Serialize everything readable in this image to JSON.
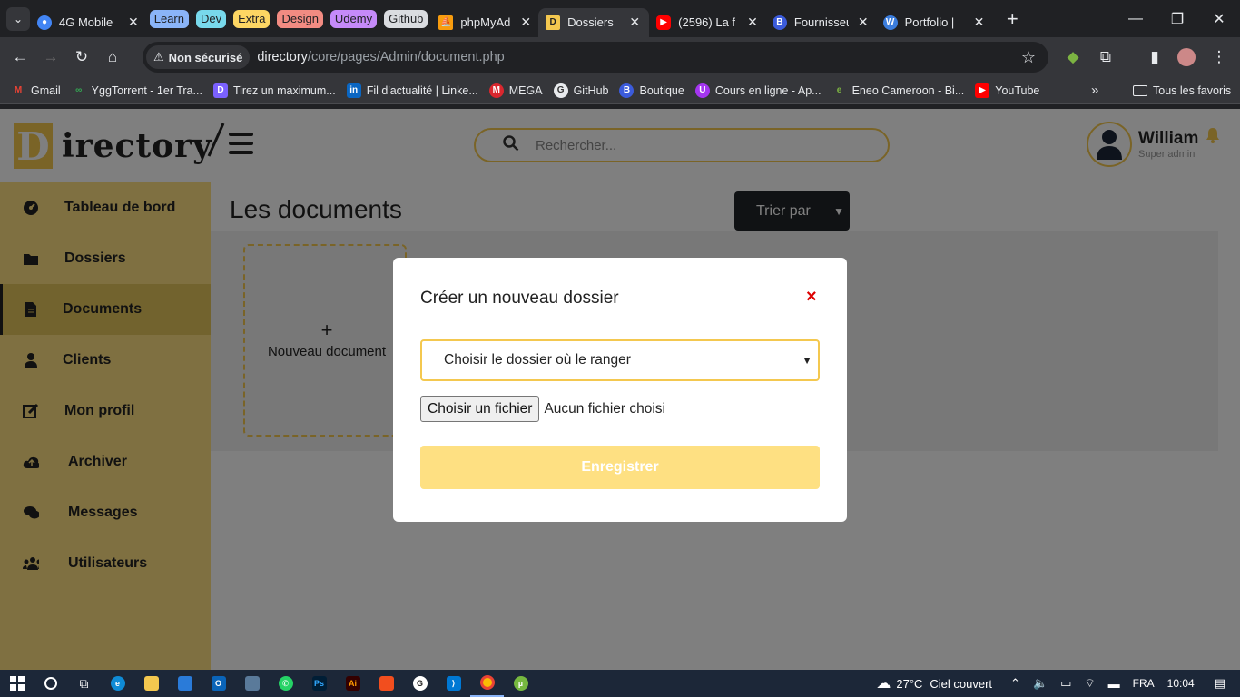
{
  "browser": {
    "tabs": [
      {
        "title": "4G Mobile",
        "favicon": "globe-icon",
        "color": "#4285f4",
        "active": false
      },
      {
        "title": "phpMyAdmin",
        "favicon": "php-sail-icon",
        "color": "#f89c0e",
        "active": false
      },
      {
        "title": "Dossiers",
        "favicon": "directory-icon",
        "color": "#f4c84f",
        "active": true
      },
      {
        "title": "(2596) La f",
        "favicon": "youtube-icon",
        "color": "#ff0000",
        "active": false
      },
      {
        "title": "Fournisseur",
        "favicon": "boutique-icon",
        "color": "#3b5bdb",
        "active": false
      },
      {
        "title": "Portfolio | ",
        "favicon": "wordpress-icon",
        "color": "#3b7ddd",
        "active": false
      }
    ],
    "tab_groups": [
      {
        "label": "Learn",
        "color": "#8ab4f8"
      },
      {
        "label": "Dev",
        "color": "#78d9ec"
      },
      {
        "label": "Extra",
        "color": "#fdd663"
      },
      {
        "label": "Design",
        "color": "#f28b82"
      },
      {
        "label": "Udemy",
        "color": "#c58af9"
      },
      {
        "label": "Github",
        "color": "#dadce0"
      }
    ],
    "security_label": "Non sécurisé",
    "url_host": "directory",
    "url_path": "/core/pages/Admin/document.php",
    "bookmarks": [
      {
        "label": "Gmail",
        "icon": "gmail-icon",
        "color": "#ea4335"
      },
      {
        "label": "YggTorrent - 1er Tra...",
        "icon": "ygg-icon",
        "color": "#34a853"
      },
      {
        "label": "Tirez un maximum...",
        "icon": "d-icon",
        "color": "#7b61ff"
      },
      {
        "label": "Fil d'actualité | Linke...",
        "icon": "linkedin-icon",
        "color": "#0a66c2"
      },
      {
        "label": "MEGA",
        "icon": "mega-icon",
        "color": "#d9272e"
      },
      {
        "label": "GitHub",
        "icon": "github-icon",
        "color": "#333333"
      },
      {
        "label": "Boutique",
        "icon": "boutique-icon",
        "color": "#3b5bdb"
      },
      {
        "label": "Cours en ligne - Ap...",
        "icon": "udemy-icon",
        "color": "#a435f0"
      },
      {
        "label": "Eneo Cameroon - Bi...",
        "icon": "eneo-icon",
        "color": "#7cb342"
      },
      {
        "label": "YouTube",
        "icon": "youtube-icon",
        "color": "#ff0000"
      }
    ],
    "all_bookmarks": "Tous les favoris"
  },
  "app": {
    "logo_letter": "D",
    "logo_text": "irectory",
    "search_placeholder": "Rechercher...",
    "user_name": "William",
    "user_role": "Super admin",
    "sidebar": [
      {
        "label": "Tableau de bord",
        "icon": "dashboard-icon",
        "active": false
      },
      {
        "label": "Dossiers",
        "icon": "folder-icon",
        "active": false
      },
      {
        "label": "Documents",
        "icon": "document-icon",
        "active": true
      },
      {
        "label": "Clients",
        "icon": "user-icon",
        "active": false
      },
      {
        "label": "Mon profil",
        "icon": "edit-icon",
        "active": false
      },
      {
        "label": "Archiver",
        "icon": "cloud-upload-icon",
        "active": false
      },
      {
        "label": "Messages",
        "icon": "comments-icon",
        "active": false
      },
      {
        "label": "Utilisateurs",
        "icon": "users-icon",
        "active": false
      }
    ],
    "page_title": "Les documents",
    "sort_label": "Trier par",
    "new_document_label": "Nouveau document",
    "accent_color": "#f4c84f"
  },
  "modal": {
    "title": "Créer un nouveau dossier",
    "close_symbol": "×",
    "folder_select_value": "Choisir le dossier où le ranger",
    "file_button": "Choisir un fichier",
    "file_status": "Aucun fichier choisi",
    "save_button": "Enregistrer"
  },
  "taskbar": {
    "weather_temp": "27°C",
    "weather_text": "Ciel couvert",
    "language": "FRA",
    "time": "10:04"
  }
}
